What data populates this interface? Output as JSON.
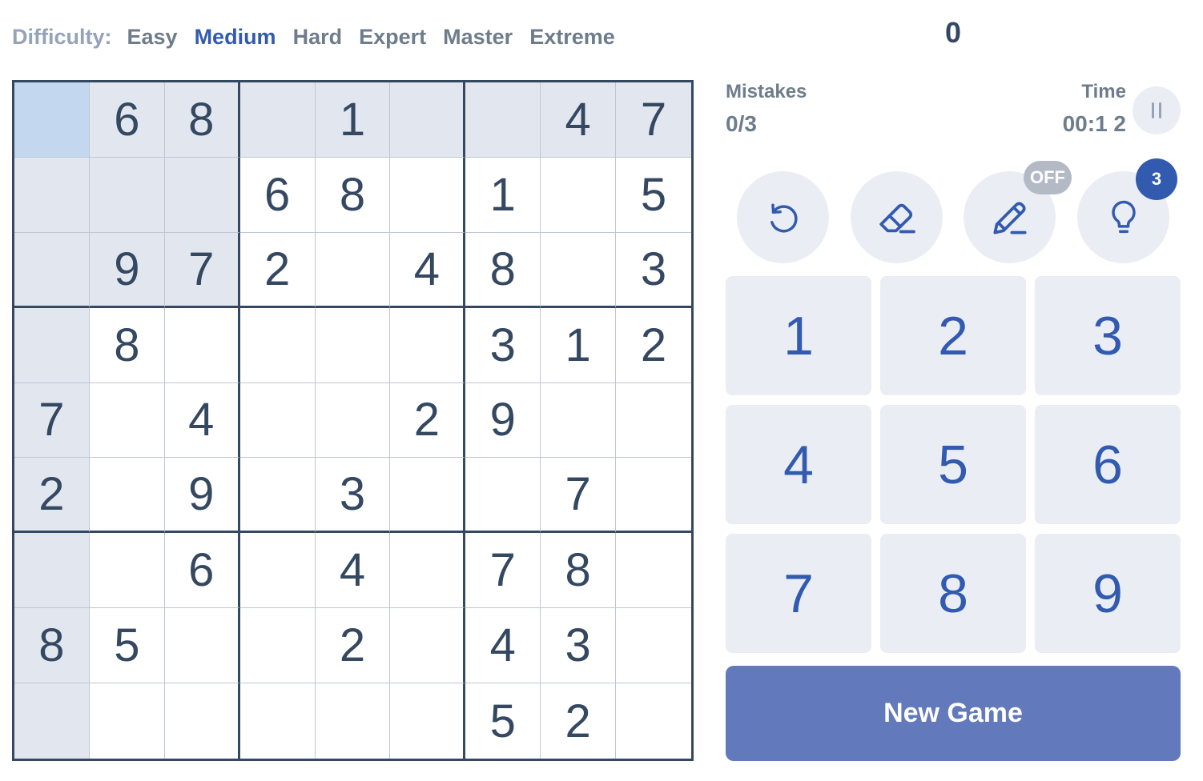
{
  "difficulty": {
    "label": "Difficulty:",
    "levels": [
      "Easy",
      "Medium",
      "Hard",
      "Expert",
      "Master",
      "Extreme"
    ],
    "selected": "Medium"
  },
  "score": "0",
  "stats": {
    "mistakes_label": "Mistakes",
    "mistakes_value": "0/3",
    "time_label": "Time",
    "time_value": "00:1 2"
  },
  "tools": {
    "undo_icon": "undo-icon",
    "erase_icon": "eraser-icon",
    "notes_icon": "pencil-icon",
    "notes_state": "OFF",
    "hint_icon": "lightbulb-icon",
    "hint_count": "3"
  },
  "numpad": [
    "1",
    "2",
    "3",
    "4",
    "5",
    "6",
    "7",
    "8",
    "9"
  ],
  "new_game_label": "New Game",
  "board": {
    "cells": [
      [
        "",
        "6",
        "8",
        "",
        "1",
        "",
        "",
        "4",
        "7"
      ],
      [
        "",
        "",
        "",
        "6",
        "8",
        "",
        "1",
        "",
        "5"
      ],
      [
        "",
        "9",
        "7",
        "2",
        "",
        "4",
        "8",
        "",
        "3"
      ],
      [
        "",
        "8",
        "",
        "",
        "",
        "",
        "3",
        "1",
        "2"
      ],
      [
        "7",
        "",
        "4",
        "",
        "",
        "2",
        "9",
        "",
        ""
      ],
      [
        "2",
        "",
        "9",
        "",
        "3",
        "",
        "",
        "7",
        ""
      ],
      [
        "",
        "",
        "6",
        "",
        "4",
        "",
        "7",
        "8",
        ""
      ],
      [
        "8",
        "5",
        "",
        "",
        "2",
        "",
        "4",
        "3",
        ""
      ],
      [
        "",
        "",
        "",
        "",
        "",
        "",
        "5",
        "2",
        ""
      ]
    ],
    "selected_row": 1,
    "selected_col": 1
  },
  "colors": {
    "selected_cell": "#c3d7ee",
    "highlighted_cell": "#e2e7ef",
    "accent": "#325aaf",
    "new_game_button": "#6279bc"
  }
}
